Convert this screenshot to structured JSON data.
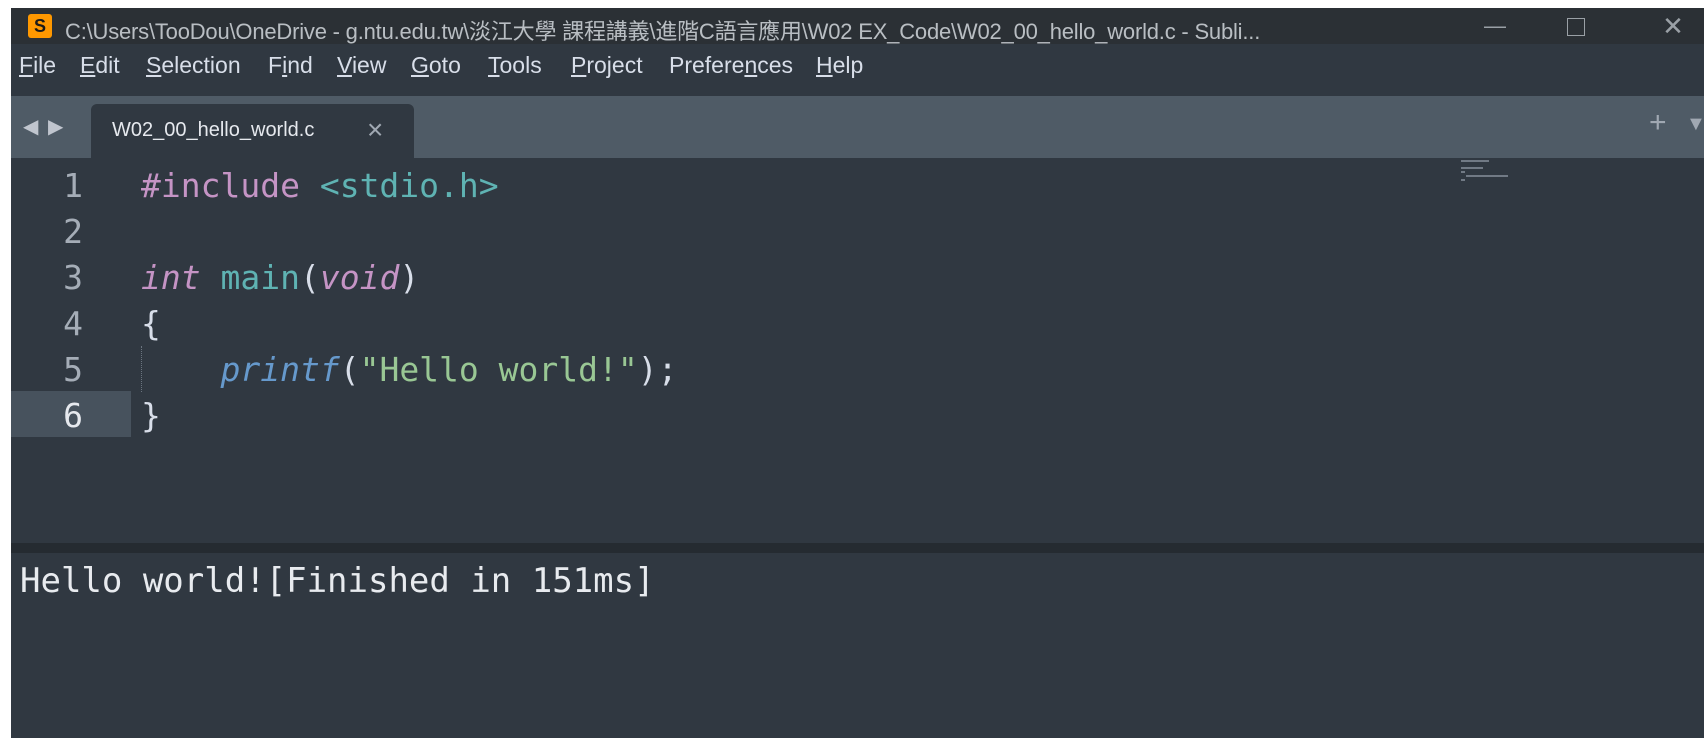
{
  "window": {
    "title": "C:\\Users\\TooDou\\OneDrive - g.ntu.edu.tw\\淡江大學 課程講義\\進階C語言應用\\W02 EX_Code\\W02_00_hello_world.c - Subli...",
    "app_icon": "sublime-text-icon",
    "controls": {
      "minimize": "—",
      "maximize": "maximize-icon",
      "close": "✕"
    }
  },
  "menu": {
    "items": [
      {
        "underline": "F",
        "rest": "ile"
      },
      {
        "underline": "E",
        "rest": "dit"
      },
      {
        "underline": "S",
        "rest": "election"
      },
      {
        "pre": "F",
        "underline": "i",
        "rest": "nd"
      },
      {
        "underline": "V",
        "rest": "iew"
      },
      {
        "underline": "G",
        "rest": "oto"
      },
      {
        "underline": "T",
        "rest": "ools"
      },
      {
        "underline": "P",
        "rest": "roject"
      },
      {
        "pre": "Prefere",
        "underline": "n",
        "rest": "ces"
      },
      {
        "underline": "H",
        "rest": "elp"
      }
    ]
  },
  "tabs": {
    "nav_arrows": "◀ ▶",
    "active": {
      "label": "W02_00_hello_world.c",
      "close": "×"
    },
    "new_tab": "+",
    "dropdown": "▼"
  },
  "editor": {
    "lines": [
      {
        "num": "1",
        "tokens": {
          "pp": "#include",
          "sp": " ",
          "inc": "<stdio.h>"
        }
      },
      {
        "num": "2"
      },
      {
        "num": "3",
        "tokens": {
          "kw": "int",
          "sp": " ",
          "main": "main",
          "open": "(",
          "arg": "void",
          "close": ")"
        }
      },
      {
        "num": "4",
        "tokens": {
          "brace": "{"
        }
      },
      {
        "num": "5",
        "tokens": {
          "indent": "    ",
          "fn": "printf",
          "open": "(",
          "str": "\"Hello world!\"",
          "close": ");"
        }
      },
      {
        "num": "6",
        "tokens": {
          "brace": "}"
        }
      }
    ],
    "active_line": "6"
  },
  "output": {
    "text": "Hello world![Finished in 151ms]"
  },
  "colors": {
    "background": "#303841",
    "tabbar": "#4f5b66",
    "keyword": "#c594c5",
    "function": "#6699cc",
    "include": "#5fb3b3",
    "string": "#99c794"
  }
}
